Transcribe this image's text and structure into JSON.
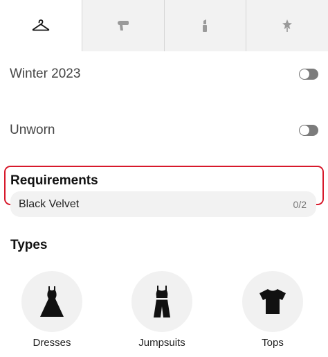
{
  "tabs": [
    {
      "icon": "hanger-icon",
      "active": true
    },
    {
      "icon": "hair-dryer-icon",
      "active": false
    },
    {
      "icon": "lipstick-icon",
      "active": false
    },
    {
      "icon": "star-pin-icon",
      "active": false
    }
  ],
  "filters": [
    {
      "label": "Winter 2023",
      "enabled": false
    },
    {
      "label": "Unworn",
      "enabled": false
    }
  ],
  "requirements": {
    "title": "Requirements",
    "items": [
      {
        "label": "Black Velvet",
        "count": "0/2"
      }
    ]
  },
  "types": {
    "title": "Types",
    "items": [
      {
        "label": "Dresses",
        "icon": "dress-icon"
      },
      {
        "label": "Jumpsuits",
        "icon": "jumpsuit-icon"
      },
      {
        "label": "Tops",
        "icon": "tshirt-icon"
      }
    ]
  },
  "colors": {
    "highlight_border": "#d7192b",
    "toggle_off": "#7c7c7c",
    "tab_bar_bg": "#f2f2f2"
  }
}
